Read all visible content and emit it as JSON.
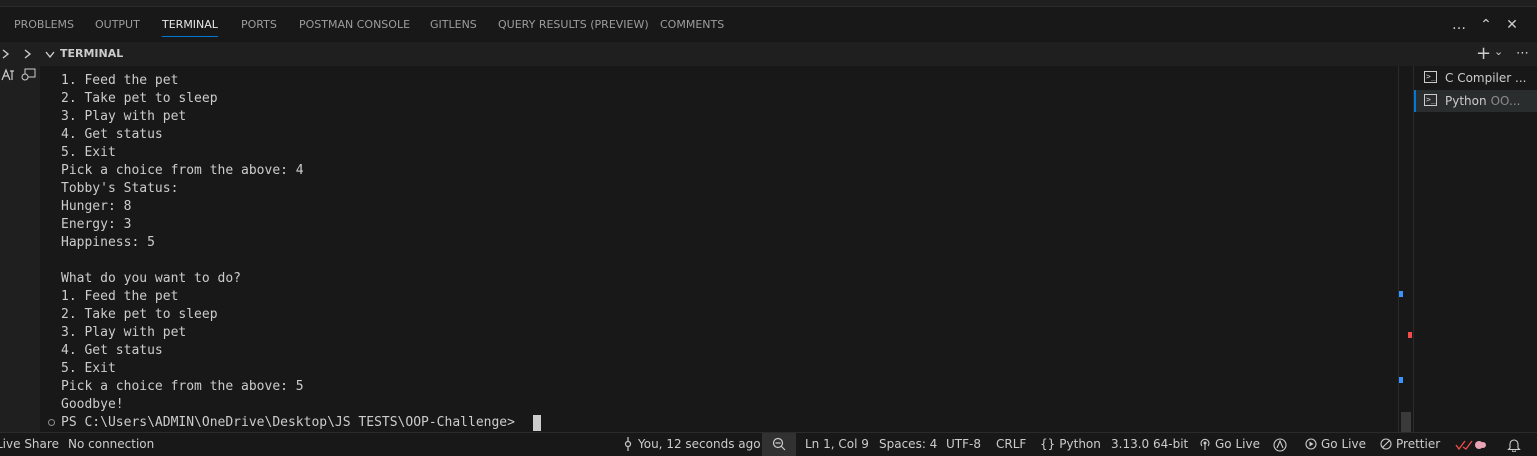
{
  "panel": {
    "tabs": [
      {
        "label": "PROBLEMS"
      },
      {
        "label": "OUTPUT"
      },
      {
        "label": "TERMINAL"
      },
      {
        "label": "PORTS"
      },
      {
        "label": "POSTMAN CONSOLE"
      },
      {
        "label": "GITLENS"
      },
      {
        "label": "QUERY RESULTS (PREVIEW)"
      },
      {
        "label": "COMMENTS"
      }
    ],
    "active_tab": "TERMINAL",
    "actions": {
      "more": "…",
      "maximize": "⌃",
      "close": "✕"
    }
  },
  "terminal": {
    "header_label": "TERMINAL",
    "new_terminal": "+",
    "dropdown": "⌄",
    "more": "⋯",
    "lines": [
      "1. Feed the pet",
      "2. Take pet to sleep",
      "3. Play with pet",
      "4. Get status",
      "5. Exit",
      "Pick a choice from the above: 4",
      "Tobby's Status:",
      "Hunger: 8",
      "Energy: 3",
      "Happiness: 5",
      "",
      "What do you want to do?",
      "1. Feed the pet",
      "2. Take pet to sleep",
      "3. Play with pet",
      "4. Get status",
      "5. Exit",
      "Pick a choice from the above: 5",
      "Goodbye!",
      "PS C:\\Users\\ADMIN\\OneDrive\\Desktop\\JS TESTS\\OOP-Challenge> "
    ],
    "list": [
      {
        "name": "C Compiler ...",
        "sub": "",
        "selected": false
      },
      {
        "name": "Python",
        "sub": "OO...",
        "selected": true
      }
    ]
  },
  "statusbar": {
    "left": [
      {
        "label": "Live Share"
      },
      {
        "label": "No connection"
      }
    ],
    "right": [
      {
        "label": "You, 12 seconds ago"
      },
      {
        "label": "Ln 1, Col 9"
      },
      {
        "label": "Spaces: 4"
      },
      {
        "label": "UTF-8"
      },
      {
        "label": "CRLF"
      },
      {
        "label": "Python"
      },
      {
        "label": "3.13.0 64-bit"
      },
      {
        "label": "Go Live"
      },
      {
        "label": "Go Live"
      },
      {
        "label": "Prettier"
      }
    ],
    "braces": "{}"
  },
  "colors": {
    "accent": "#0078d4",
    "marker_blue": "#3794ff",
    "marker_red": "#f14c4c"
  }
}
